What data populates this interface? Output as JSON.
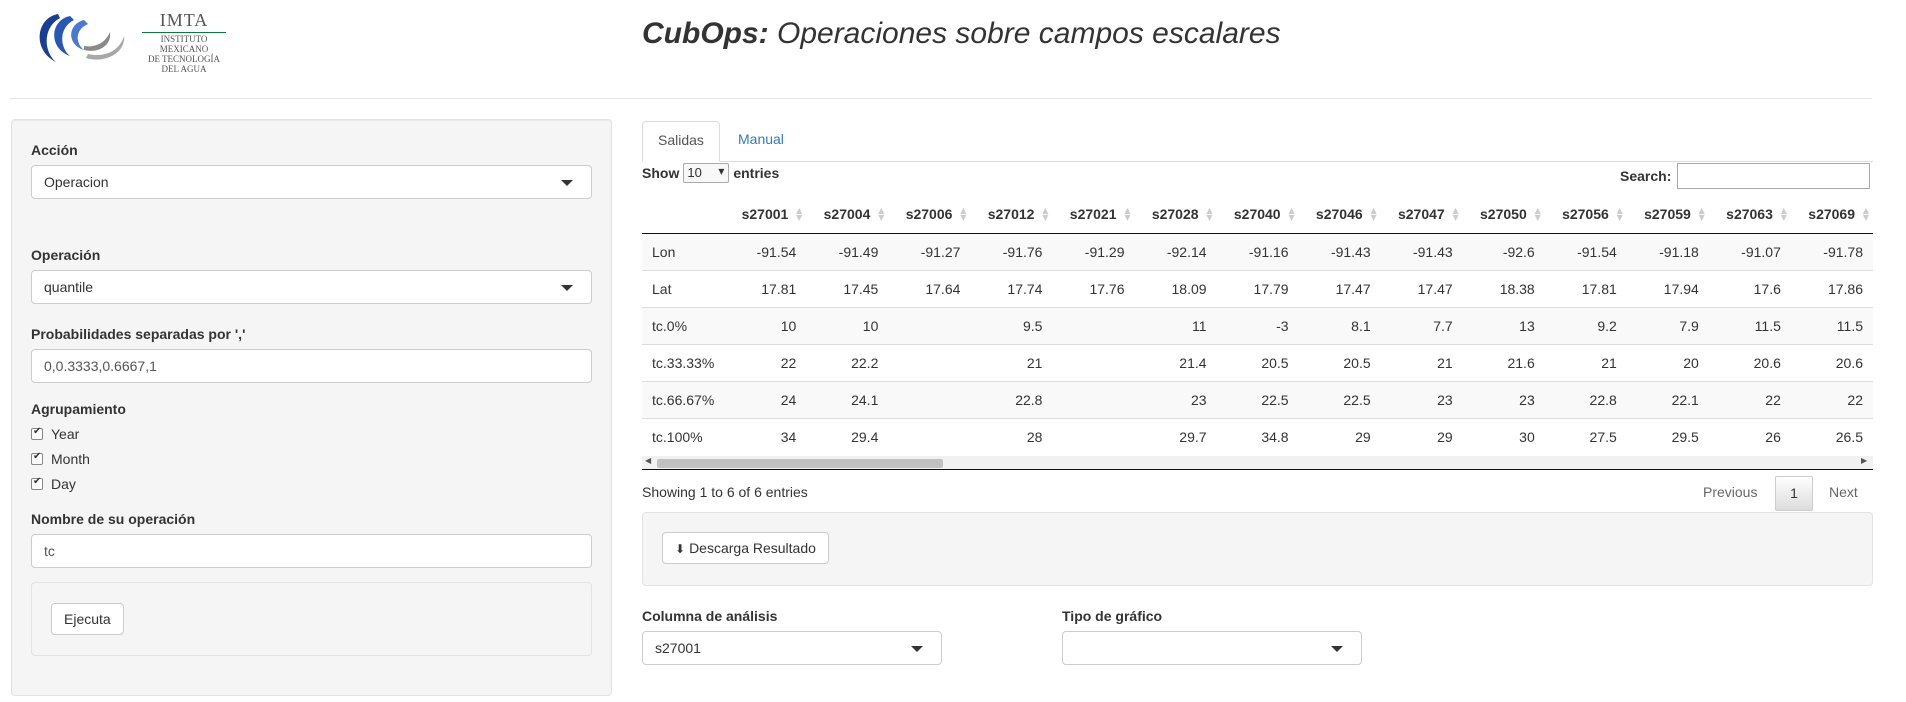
{
  "header": {
    "logo": {
      "name": "IMTA",
      "subtitle_lines": [
        "INSTITUTO MEXICANO",
        "DE TECNOLOGÍA",
        "DEL AGUA"
      ]
    },
    "title_bold": "CubOps:",
    "title_rest": " Operaciones sobre campos escalares"
  },
  "sidebar": {
    "accion": {
      "label": "Acción",
      "value": "Operacion"
    },
    "operacion": {
      "label": "Operación",
      "value": "quantile"
    },
    "probabilidades": {
      "label": "Probabilidades separadas por ','",
      "value": "0,0.3333,0.6667,1"
    },
    "agrupamiento": {
      "label": "Agrupamiento",
      "options": [
        {
          "label": "Year",
          "checked": true
        },
        {
          "label": "Month",
          "checked": true
        },
        {
          "label": "Day",
          "checked": true
        }
      ]
    },
    "nombre": {
      "label": "Nombre de su operación",
      "value": "tc"
    },
    "run_button": "Ejecuta"
  },
  "tabs": [
    {
      "label": "Salidas",
      "active": true
    },
    {
      "label": "Manual",
      "active": false
    }
  ],
  "table_controls": {
    "show_label": "Show",
    "length_value": "10",
    "entries_label": "entries",
    "search_label": "Search:",
    "search_value": ""
  },
  "table": {
    "columns": [
      "",
      "s27001",
      "s27004",
      "s27006",
      "s27012",
      "s27021",
      "s27028",
      "s27040",
      "s27046",
      "s27047",
      "s27050",
      "s27056",
      "s27059",
      "s27063",
      "s27069"
    ],
    "rows": [
      [
        "Lon",
        "-91.54",
        "-91.49",
        "-91.27",
        "-91.76",
        "-91.29",
        "-92.14",
        "-91.16",
        "-91.43",
        "-91.43",
        "-92.6",
        "-91.54",
        "-91.18",
        "-91.07",
        "-91.78"
      ],
      [
        "Lat",
        "17.81",
        "17.45",
        "17.64",
        "17.74",
        "17.76",
        "18.09",
        "17.79",
        "17.47",
        "17.47",
        "18.38",
        "17.81",
        "17.94",
        "17.6",
        "17.86"
      ],
      [
        "tc.0%",
        "10",
        "10",
        "",
        "9.5",
        "",
        "11",
        "-3",
        "8.1",
        "7.7",
        "13",
        "9.2",
        "7.9",
        "11.5",
        "11.5"
      ],
      [
        "tc.33.33%",
        "22",
        "22.2",
        "",
        "21",
        "",
        "21.4",
        "20.5",
        "20.5",
        "21",
        "21.6",
        "21",
        "20",
        "20.6",
        "20.6"
      ],
      [
        "tc.66.67%",
        "24",
        "24.1",
        "",
        "22.8",
        "",
        "23",
        "22.5",
        "22.5",
        "23",
        "23",
        "22.8",
        "22.1",
        "22",
        "22"
      ],
      [
        "tc.100%",
        "34",
        "29.4",
        "",
        "28",
        "",
        "29.7",
        "34.8",
        "29",
        "29",
        "30",
        "27.5",
        "29.5",
        "26",
        "26.5"
      ]
    ]
  },
  "pagination": {
    "info": "Showing 1 to 6 of 6 entries",
    "previous": "Previous",
    "current": "1",
    "next": "Next"
  },
  "download_button": "Descarga Resultado",
  "analysis": {
    "columna_label": "Columna de análisis",
    "columna_value": "s27001",
    "tipo_label": "Tipo de gráfico",
    "tipo_value": ""
  }
}
